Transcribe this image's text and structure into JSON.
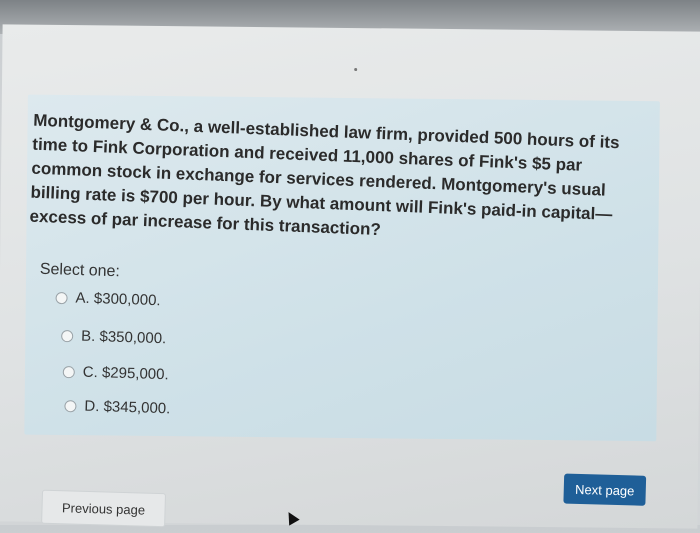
{
  "question": {
    "text": "Montgomery & Co., a well-established law firm, provided 500 hours of its time to Fink Corporation and received 11,000 shares of Fink's $5 par common stock in exchange for services rendered. Montgomery's usual billing rate is $700 per hour. By what amount will Fink's paid-in capital—excess of par increase for this transaction?"
  },
  "answer": {
    "select_label": "Select one:",
    "options": [
      {
        "label": "A. $300,000."
      },
      {
        "label": "B. $350,000."
      },
      {
        "label": "C. $295,000."
      },
      {
        "label": "D. $345,000."
      }
    ]
  },
  "navigation": {
    "next_label": "Next page",
    "previous_label": "Previous page"
  },
  "colors": {
    "panel_background": "#cfe1e8",
    "next_button": "#1f5f98",
    "text": "#2b2b2b"
  }
}
